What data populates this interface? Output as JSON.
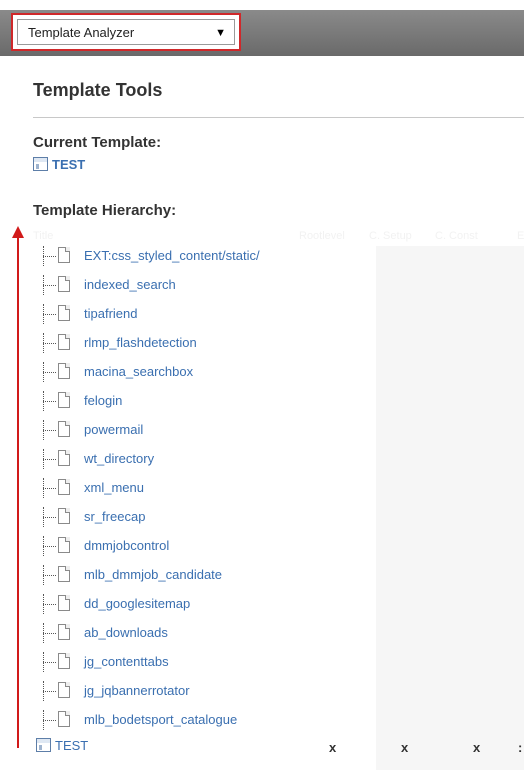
{
  "header": {
    "selector_value": "Template Analyzer",
    "selector_arrow": "▼"
  },
  "main": {
    "title": "Template Tools",
    "current_template_label": "Current Template:",
    "current_template_name": "TEST",
    "hierarchy_label": "Template Hierarchy:",
    "table_headers": [
      "Title",
      "Rootlevel",
      "C. Setup",
      "C. Const",
      "E"
    ],
    "hierarchy_items": [
      "EXT:css_styled_content/static/",
      "indexed_search",
      "tipafriend",
      "rlmp_flashdetection",
      "macina_searchbox",
      "felogin",
      "powermail",
      "wt_directory",
      "xml_menu",
      "sr_freecap",
      "dmmjobcontrol",
      "mlb_dmmjob_candidate",
      "dd_googlesitemap",
      "ab_downloads",
      "jg_contenttabs",
      "jg_jqbannerrotator",
      "mlb_bodetsport_catalogue"
    ],
    "root_row": {
      "name": "TEST",
      "marks": [
        "x",
        "x",
        "x",
        ":"
      ]
    }
  },
  "colors": {
    "link": "#3a6fb0",
    "highlight_border": "#d0282a",
    "arrow": "#d11a1a",
    "topbar": "#7a7a7a"
  },
  "icons": {
    "template": "template-icon",
    "file": "file-icon",
    "dropdown": "dropdown-arrow-icon"
  }
}
